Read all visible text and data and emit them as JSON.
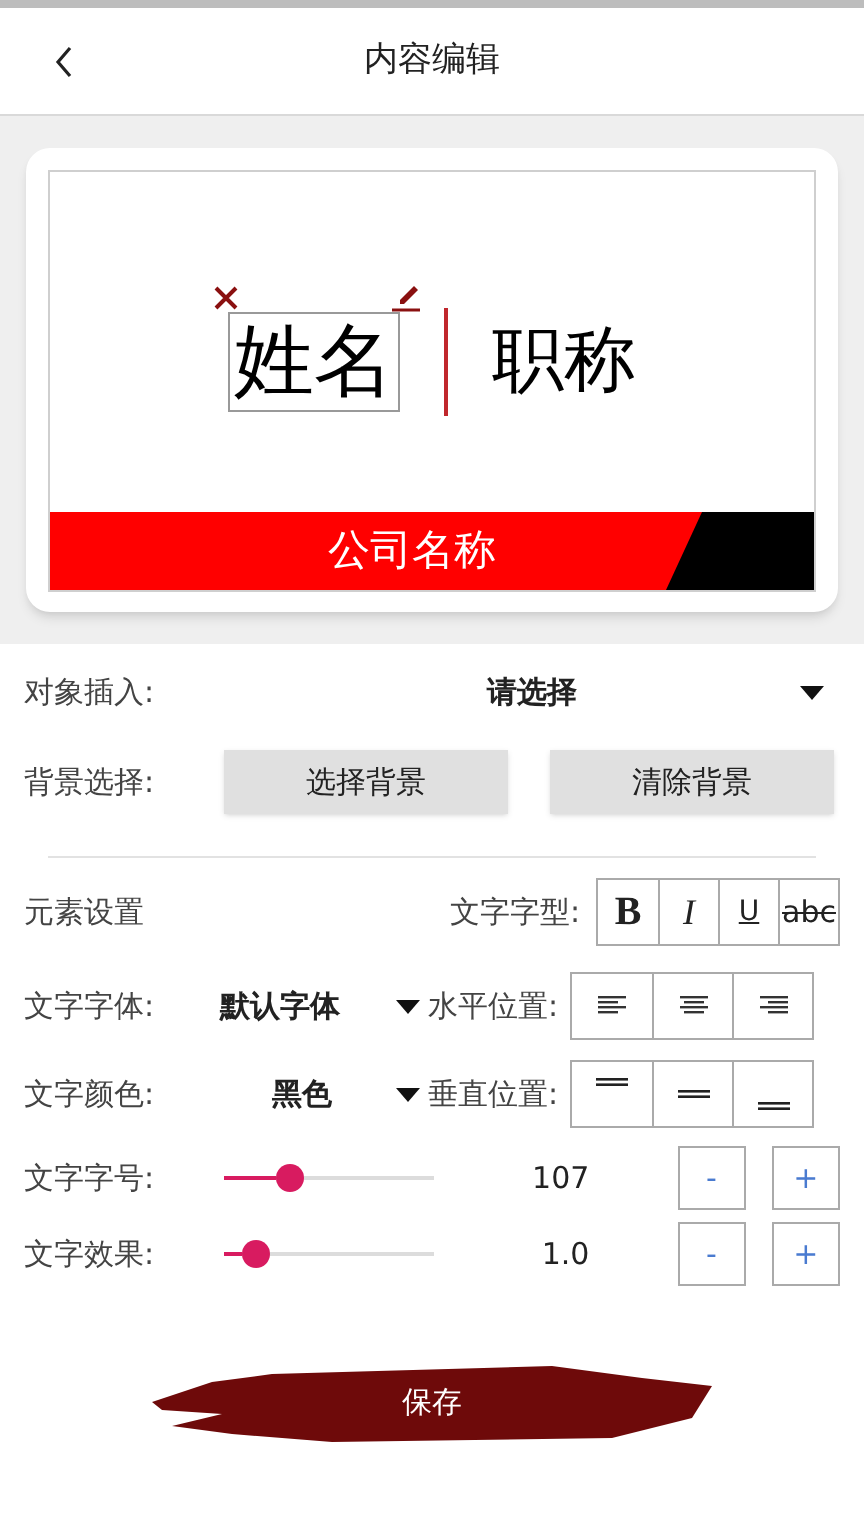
{
  "header": {
    "title": "内容编辑"
  },
  "card": {
    "name": "姓名",
    "title": "职称",
    "company": "公司名称"
  },
  "insert": {
    "label": "对象插入:",
    "value": "请选择"
  },
  "background": {
    "label": "背景选择:",
    "buttons": [
      "选择背景",
      "清除背景"
    ]
  },
  "element": {
    "label": "元素设置",
    "style_label": "文字字型:",
    "styles": [
      {
        "kind": "bold",
        "text": "B"
      },
      {
        "kind": "italic",
        "text": "I"
      },
      {
        "kind": "underline",
        "text": "U"
      },
      {
        "kind": "strike",
        "text": "abc"
      }
    ]
  },
  "font": {
    "label": "文字字体:",
    "value": "默认字体",
    "align_label": "水平位置:",
    "aligns": [
      {
        "kind": "left"
      },
      {
        "kind": "center"
      },
      {
        "kind": "right"
      }
    ]
  },
  "color": {
    "label": "文字颜色:",
    "value": "黑色",
    "valign_label": "垂直位置:",
    "valigns": [
      {
        "kind": "top"
      },
      {
        "kind": "middle"
      },
      {
        "kind": "bottom"
      }
    ]
  },
  "sliders": [
    {
      "label": "文字字号:",
      "level": 0.28,
      "reading": "107",
      "minus": "-",
      "plus": "+"
    },
    {
      "label": "文字效果:",
      "level": 0.1,
      "reading": "1.0",
      "minus": "-",
      "plus": "+"
    }
  ],
  "save": "保存"
}
